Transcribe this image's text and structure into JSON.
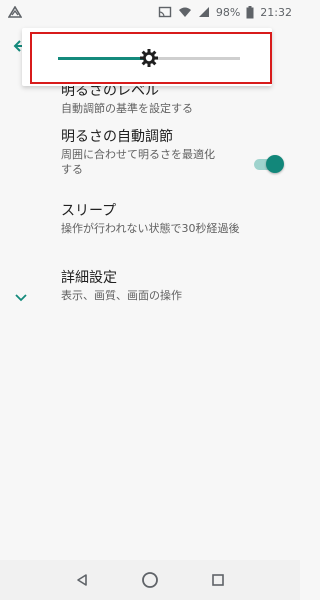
{
  "status_bar": {
    "battery_text": "98%",
    "time": "21:32",
    "icons": [
      "app-notification-icon",
      "cast-icon",
      "wifi-icon",
      "signal-icon",
      "battery-icon"
    ]
  },
  "header": {
    "back_icon": "arrow-back-icon"
  },
  "brightness": {
    "level": 0.5,
    "thumb_icon": "brightness-gear-icon",
    "accent_color": "#148a7c",
    "highlight_color": "#d81b1b"
  },
  "settings": {
    "brightness_level": {
      "title": "明るさのレベル",
      "summary": "自動調節の基準を設定する"
    },
    "adaptive_brightness": {
      "title": "明るさの自動調節",
      "summary_line1": "周囲に合わせて明るさを最適化",
      "summary_line2": "する",
      "enabled": true
    },
    "sleep": {
      "title": "スリープ",
      "summary": "操作が行われない状態で30秒経過後"
    },
    "advanced": {
      "title": "詳細設定",
      "summary": "表示、画質、画面の操作",
      "icon": "chevron-down-icon"
    }
  },
  "nav_bar": {
    "buttons": [
      "back-triangle-icon",
      "home-circle-icon",
      "recents-square-icon"
    ]
  }
}
